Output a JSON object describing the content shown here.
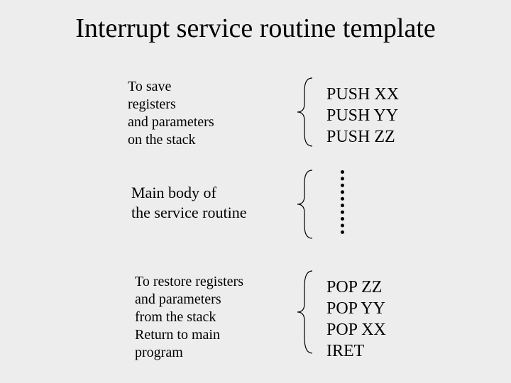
{
  "title": "Interrupt service routine template",
  "sections": [
    {
      "desc": "To save\nregisters\nand parameters\non the stack",
      "code": "PUSH XX\nPUSH YY\nPUSH ZZ"
    },
    {
      "desc": "Main body of\nthe service routine",
      "code": ""
    },
    {
      "desc": "To restore registers\nand parameters\nfrom the stack\nReturn to main\nprogram",
      "code": "POP ZZ\nPOP YY\nPOP XX\nIRET"
    }
  ]
}
